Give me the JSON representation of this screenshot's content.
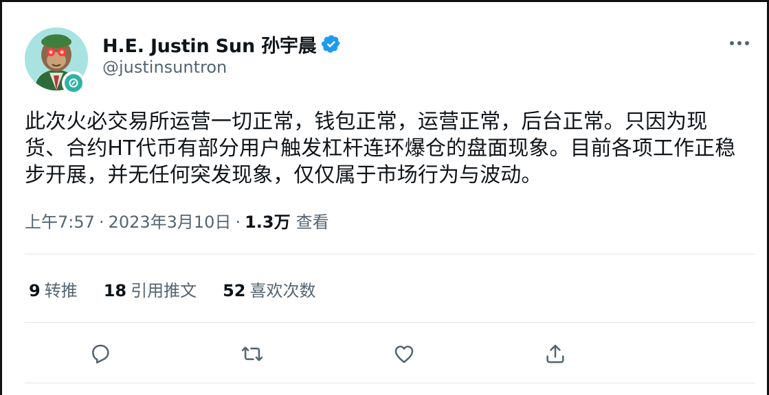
{
  "author": {
    "display_name": "H.E. Justin Sun 孙宇晨",
    "handle": "@justinsuntron",
    "avatar_icon": "nft-ape-avatar",
    "badge_icon": "verified-badge-icon",
    "badge_color": "#1d9bf0"
  },
  "tweet": {
    "text": "此次火必交易所运营一切正常，钱包正常，运营正常，后台正常。只因为现货、合约HT代币有部分用户触发杠杆连环爆仓的盘面现象。目前各项工作正稳步开展，并无任何突发现象，仅仅属于市场行为与波动。"
  },
  "meta": {
    "time": "上午7:57",
    "separator": "·",
    "date": "2023年3月10日",
    "views_count": "1.3万",
    "views_label": "查看"
  },
  "stats": [
    {
      "count": "9",
      "label": "转推"
    },
    {
      "count": "18",
      "label": "引用推文"
    },
    {
      "count": "52",
      "label": "喜欢次数"
    }
  ],
  "actions": [
    "reply-icon",
    "retweet-icon",
    "like-icon",
    "share-icon"
  ],
  "colors": {
    "text_primary": "#0f1419",
    "text_secondary": "#536471",
    "divider": "#e1e5e8",
    "icon": "#536471"
  }
}
